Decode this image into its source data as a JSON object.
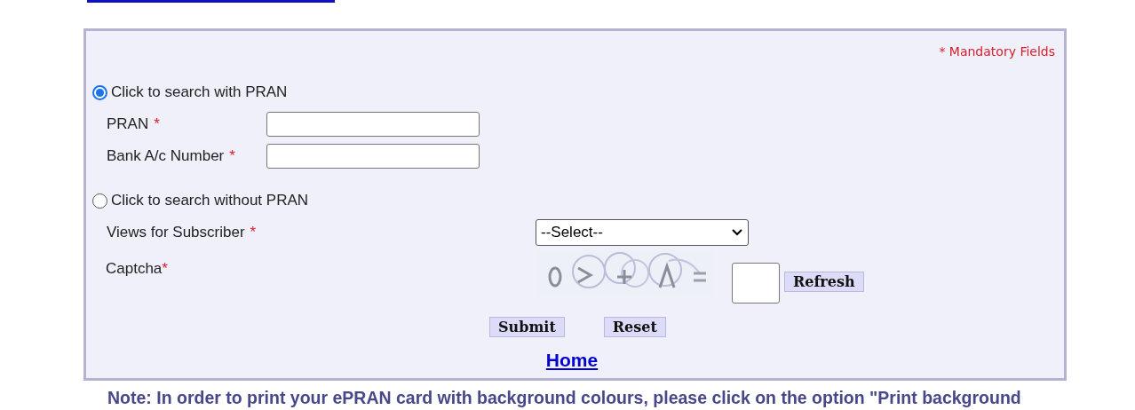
{
  "form": {
    "mandatory_note": "* Mandatory Fields",
    "options": [
      {
        "label": "Click to search with PRAN",
        "selected": true,
        "fields": [
          {
            "kind": "text",
            "label": "PRAN",
            "mark": "*"
          },
          {
            "kind": "text",
            "label": "Bank A/c Number",
            "mark": "*"
          }
        ]
      },
      {
        "label": "Click to search without PRAN",
        "selected": false,
        "fields": [
          {
            "kind": "select",
            "label": "Views for Subscriber",
            "mark": "*",
            "value": "--Select--"
          }
        ]
      }
    ],
    "captcha": {
      "label": "Captcha",
      "mark": "*",
      "refresh": "Refresh"
    },
    "buttons": [
      "Submit",
      "Reset"
    ],
    "home_link": "Home"
  },
  "note": "Note: In order to print your ePRAN card with background colours, please click on the option \"Print background"
}
